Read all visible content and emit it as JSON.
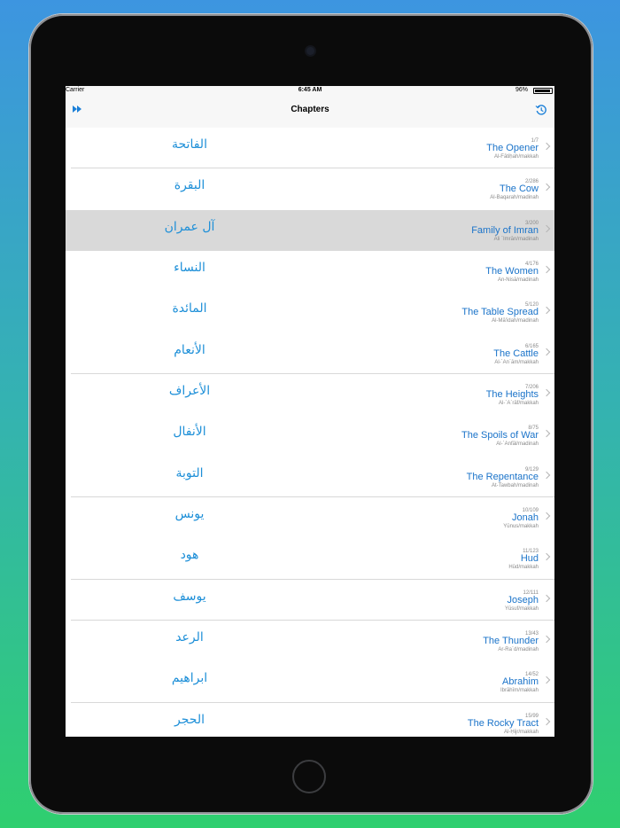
{
  "status_bar": {
    "carrier": "Carrier",
    "time": "6:45 AM",
    "battery": "96%",
    "battery_level": 0.96
  },
  "nav": {
    "title": "Chapters",
    "left_icon": "fast-forward-icon",
    "right_icon": "history-icon"
  },
  "chapters": [
    {
      "arabic": "الفاتحة",
      "count": "1/7",
      "english": "The Opener",
      "translit": "Al-Fātiḥah/makkah",
      "selected": false,
      "separator": true
    },
    {
      "arabic": "البقرة",
      "count": "2/286",
      "english": "The Cow",
      "translit": "Al-Baqarah/madinah",
      "selected": false,
      "separator": false
    },
    {
      "arabic": "آل عمران",
      "count": "3/200",
      "english": "Family of Imran",
      "translit": "Āli `Imrān/madinah",
      "selected": true,
      "separator": false
    },
    {
      "arabic": "النساء",
      "count": "4/176",
      "english": "The Women",
      "translit": "An-Nisā/madinah",
      "selected": false,
      "separator": false
    },
    {
      "arabic": "المائدة",
      "count": "5/120",
      "english": "The Table Spread",
      "translit": "Al-Mā'idah/madinah",
      "selected": false,
      "separator": false
    },
    {
      "arabic": "الأنعام",
      "count": "6/165",
      "english": "The Cattle",
      "translit": "Al-`An`ām/makkah",
      "selected": false,
      "separator": true
    },
    {
      "arabic": "الأعراف",
      "count": "7/206",
      "english": "The Heights",
      "translit": "Al-`A`rāf/makkah",
      "selected": false,
      "separator": false
    },
    {
      "arabic": "الأنفال",
      "count": "8/75",
      "english": "The Spoils of War",
      "translit": "Al-`Anfāl/madinah",
      "selected": false,
      "separator": false
    },
    {
      "arabic": "التوبة",
      "count": "9/129",
      "english": "The Repentance",
      "translit": "At-Tawbah/madinah",
      "selected": false,
      "separator": true
    },
    {
      "arabic": "يونس",
      "count": "10/109",
      "english": "Jonah",
      "translit": "Yūnus/makkah",
      "selected": false,
      "separator": false
    },
    {
      "arabic": "هود",
      "count": "11/123",
      "english": "Hud",
      "translit": "Hūd/makkah",
      "selected": false,
      "separator": true
    },
    {
      "arabic": "يوسف",
      "count": "12/111",
      "english": "Joseph",
      "translit": "Yūsuf/makkah",
      "selected": false,
      "separator": true
    },
    {
      "arabic": "الرعد",
      "count": "13/43",
      "english": "The Thunder",
      "translit": "Ar-Ra`d/madinah",
      "selected": false,
      "separator": false
    },
    {
      "arabic": "ابراهيم",
      "count": "14/52",
      "english": "Abrahim",
      "translit": "Ibrāhīm/makkah",
      "selected": false,
      "separator": true
    },
    {
      "arabic": "الحجر",
      "count": "15/99",
      "english": "The Rocky Tract",
      "translit": "Al-Ḥijr/makkah",
      "selected": false,
      "separator": false
    }
  ],
  "colors": {
    "accent": "#1a73c9",
    "arabic_text": "#1d8fd8",
    "selected_row": "#d9d9d9"
  }
}
